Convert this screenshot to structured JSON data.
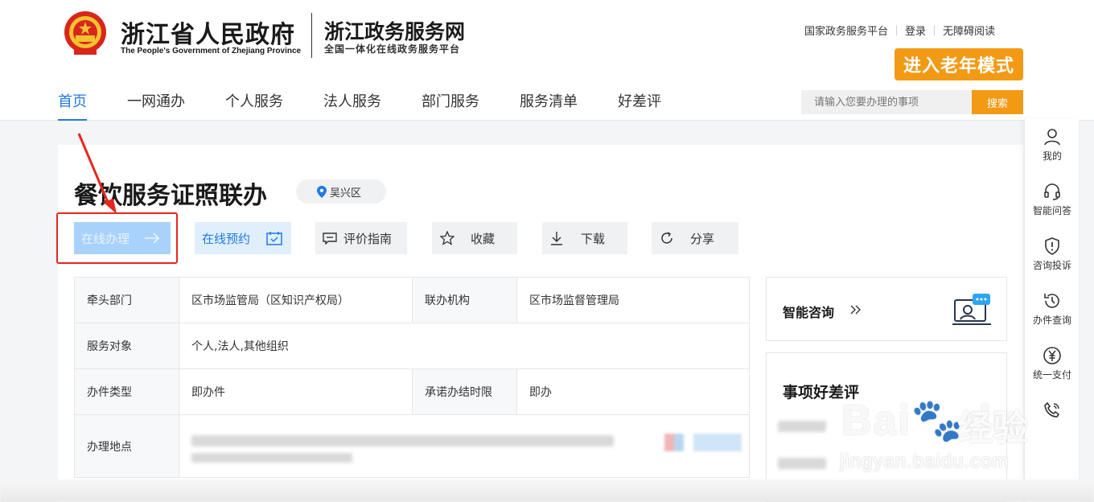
{
  "header": {
    "brand_title": "浙江省人民政府",
    "brand_en": "The People's Government of Zhejiang Province",
    "site_title": "浙江政务服务网",
    "site_sub": "全国一体化在线政务服务平台",
    "toplinks": [
      "国家政务服务平台",
      "登录",
      "无障碍阅读"
    ],
    "elder_mode": "进入老年模式"
  },
  "nav": {
    "items": [
      "首页",
      "一网通办",
      "个人服务",
      "法人服务",
      "部门服务",
      "服务清单",
      "好差评"
    ],
    "active": "首页"
  },
  "search": {
    "placeholder": "请输入您要办理的事项",
    "button": "搜索"
  },
  "sidebar": {
    "items": [
      "我的",
      "智能问答",
      "咨询投诉",
      "办件查询",
      "统一支付"
    ]
  },
  "service": {
    "title": "餐饮服务证照联办",
    "location": "吴兴区",
    "actions": {
      "online": "在线办理",
      "reserve": "在线预约",
      "guide": "评价指南",
      "favorite": "收藏",
      "download": "下载",
      "share": "分享"
    }
  },
  "info": {
    "lead_dept_label": "牵头部门",
    "lead_dept": "区市场监管局（区知识产权局）",
    "joint_org_label": "联办机构",
    "joint_org": "区市场监督管理局",
    "target_label": "服务对象",
    "target": "个人,法人,其他组织",
    "type_label": "办件类型",
    "type": "即办件",
    "deadline_label": "承诺办结时限",
    "deadline": "即办",
    "address_label": "办理地点"
  },
  "side": {
    "consult": "智能咨询",
    "rating": "事项好差评"
  },
  "watermark": {
    "brand": "Bai",
    "brand2": "du",
    "cn": "经验",
    "url": "jingyan.baidu.com"
  },
  "colors": {
    "primary": "#1f79e6",
    "accent": "#f39a15",
    "highlight": "#e8261d"
  }
}
